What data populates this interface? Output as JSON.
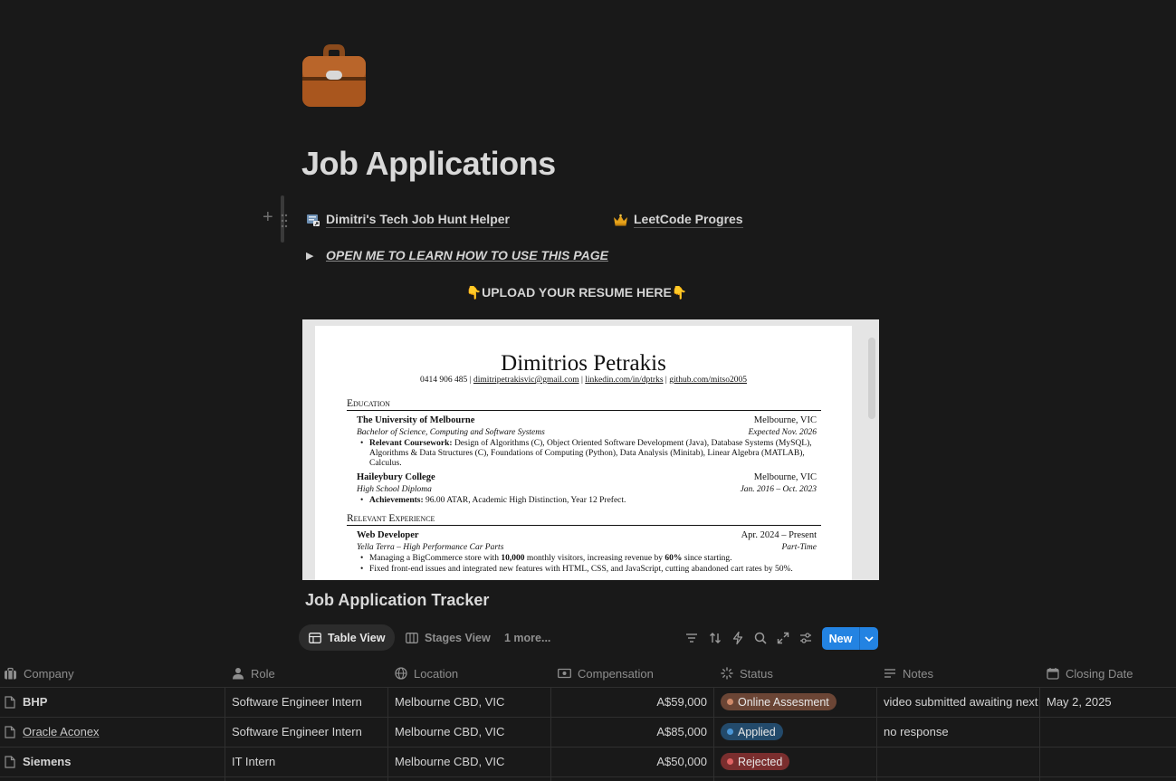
{
  "page": {
    "title": "Job Applications",
    "icon": "briefcase-icon"
  },
  "links": [
    {
      "label": "Dimitri's Tech Job Hunt Helper",
      "icon": "page-link-icon"
    },
    {
      "label": "LeetCode Progres",
      "icon": "crown-icon"
    }
  ],
  "toggle": {
    "label": "OPEN ME TO LEARN HOW TO USE THIS PAGE"
  },
  "upload_line": "👇UPLOAD YOUR RESUME HERE👇",
  "resume": {
    "name": "Dimitrios Petrakis",
    "contact_phone": "0414 906 485",
    "contact_email": "dimitripetrakisvic@gmail.com",
    "contact_linkedin": "linkedin.com/in/dptrks",
    "contact_github": "github.com/mitso2005",
    "sep": "|",
    "education_heading": "Education",
    "edu1": {
      "school": "The University of Melbourne",
      "location": "Melbourne, VIC",
      "degree": "Bachelor of Science, Computing and Software Systems",
      "dates": "Expected Nov. 2026",
      "bullet_label": "Relevant Coursework:",
      "bullet_text": "Design of Algorithms (C), Object Oriented Software Development (Java), Database Systems (MySQL), Algorithms & Data Structures (C), Foundations of Computing (Python), Data Analysis (Minitab), Linear Algebra (MATLAB), Calculus."
    },
    "edu2": {
      "school": "Haileybury College",
      "location": "Melbourne, VIC",
      "degree": "High School Diploma",
      "dates": "Jan. 2016 – Oct. 2023",
      "bullet_label": "Achievements:",
      "bullet_text": "96.00 ATAR, Academic High Distinction, Year 12 Prefect."
    },
    "experience_heading": "Relevant Experience",
    "exp1": {
      "role": "Web Developer",
      "dates": "Apr. 2024 – Present",
      "company": "Yella Terra – High Performance Car Parts",
      "type": "Part-Time",
      "b1_pre": "Managing a BigCommerce store with ",
      "b1_strong1": "10,000",
      "b1_mid": " monthly visitors, increasing revenue by ",
      "b1_strong2": "60%",
      "b1_post": " since starting.",
      "b2": "Fixed front-end issues and integrated new features with HTML, CSS, and JavaScript, cutting abandoned cart rates by 50%."
    }
  },
  "tracker": {
    "title": "Job Application Tracker",
    "views": [
      "Table View",
      "Stages View",
      "1 more..."
    ],
    "new_label": "New",
    "columns": [
      "Company",
      "Role",
      "Location",
      "Compensation",
      "Status",
      "Notes",
      "Closing Date"
    ],
    "rows": [
      {
        "company": "BHP",
        "role": "Software Engineer Intern",
        "location": "Melbourne CBD, VIC",
        "compensation": "A$59,000",
        "status": "Online Assesment",
        "status_color": "#6b4535",
        "status_dot": "#d08a6a",
        "notes": "video submitted awaiting next s",
        "closing": "May 2, 2025"
      },
      {
        "company": "Oracle Aconex",
        "role": "Software Engineer Intern",
        "location": "Melbourne CBD, VIC",
        "compensation": "A$85,000",
        "status": "Applied",
        "status_color": "#234a6b",
        "status_dot": "#4b96d6",
        "notes": "no response",
        "closing": ""
      },
      {
        "company": "Siemens",
        "role": "IT Intern",
        "location": "Melbourne CBD, VIC",
        "compensation": "A$50,000",
        "status": "Rejected",
        "status_color": "#7a2e2e",
        "status_dot": "#e06363",
        "notes": "",
        "closing": ""
      }
    ]
  },
  "colors": {
    "background": "#191919",
    "accent": "#2383e2"
  }
}
